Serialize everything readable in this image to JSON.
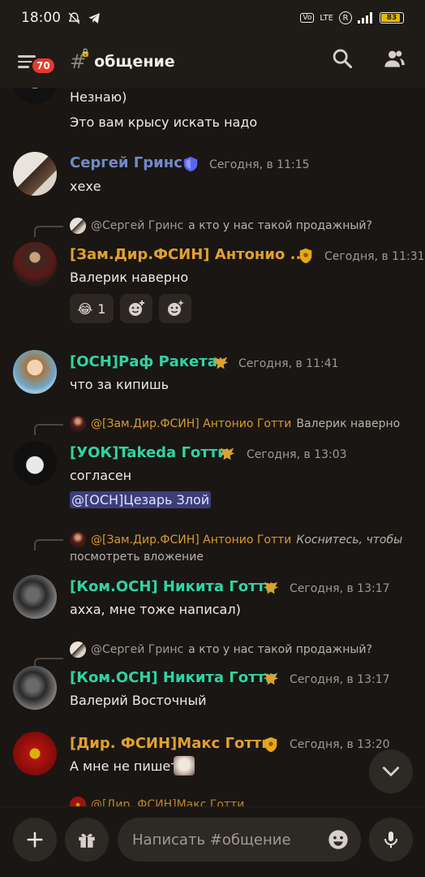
{
  "status_bar": {
    "time": "18:00",
    "battery": "83"
  },
  "header": {
    "badge": "70",
    "channel_name": "общение"
  },
  "messages": {
    "m0": {
      "lines": [
        "Незнаю)",
        "Это вам крысу искать надо"
      ]
    },
    "m1": {
      "user": "Сергей Гринс",
      "time": "Сегодня, в 11:15",
      "text": "хехе",
      "name_color": "#7289c9"
    },
    "m2": {
      "reply_user": "@Сергей Гринс",
      "reply_text": "а кто у нас такой продажный?",
      "user": "[Зам.Дир.ФСИН] Антонио ...",
      "time": "Сегодня, в 11:31",
      "text": "Валерик наверно",
      "name_color": "#e0a030",
      "reactions": [
        {
          "emoji": "😂",
          "count": "1"
        }
      ]
    },
    "m3": {
      "user": "[ОСН]Раф Ракета",
      "time": "Сегодня, в 11:41",
      "text": "что за кипишь",
      "name_color": "#2fd4a4"
    },
    "m4": {
      "reply_user": "@[Зам.Дир.ФСИН] Антонио Готти",
      "reply_text": "Валерик наверно",
      "user": "[УОК]Takeda Готти",
      "time": "Сегодня, в 13:03",
      "text": "согласен",
      "mention": "@[ОСН]Цезарь Злой",
      "name_color": "#2fd4a4"
    },
    "m5": {
      "reply_user": "@[Зам.Дир.ФСИН] Антонио Готти",
      "reply_text_1": "Коснитесь, чтобы",
      "reply_text_2": "посмотреть вложение",
      "user": "[Ком.ОСН] Никита Готти",
      "time": "Сегодня, в 13:17",
      "text": "ахха, мне тоже написал)",
      "name_color": "#2fd4a4"
    },
    "m6": {
      "reply_user": "@Сергей Гринс",
      "reply_text": "а кто у нас такой продажный?",
      "user": "[Ком.ОСН] Никита Готти",
      "time": "Сегодня, в 13:17",
      "text": "Валерий Восточный",
      "name_color": "#2fd4a4"
    },
    "m7": {
      "user": "[Дир. ФСИН]Макс Готти",
      "time": "Сегодня, в 13:20",
      "text": "А мне не пишет",
      "name_color": "#e0a030"
    },
    "m8": {
      "partial": "@[Дир. ФСИН]Макс Готти"
    }
  },
  "composer": {
    "placeholder": "Написать #общение"
  },
  "colors": {
    "teal": "#2fd4a4",
    "gold": "#e0a030",
    "blue": "#7289c9",
    "mention_bg": "#3c3e7a"
  },
  "icons": [
    "hamburger-icon",
    "hash-lock-icon",
    "search-icon",
    "members-icon",
    "shield-icon",
    "eagle-role-icon",
    "police-badge-icon",
    "add-reaction-icon",
    "chevron-down-icon",
    "plus-icon",
    "gift-icon",
    "emoji-icon",
    "microphone-icon"
  ]
}
